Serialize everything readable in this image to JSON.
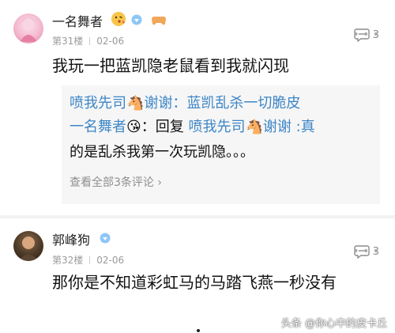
{
  "comments": [
    {
      "user": "一名舞者",
      "floor": "第31楼",
      "date": "02-06",
      "reply_count": "3",
      "text": "我玩一把蓝凯隐老鼠看到我就闪现",
      "quotes": [
        {
          "name": "喷我先司",
          "emoji": "🐴",
          "body": "谢谢：蓝凯乱杀一切脆皮"
        },
        {
          "name": "一名舞者",
          "emoji": "😘",
          "body": "：回复 ",
          "target": "喷我先司",
          "target_emoji": "🐴",
          "tail": "谢谢  :真"
        }
      ],
      "quote_continuation": "的是乱杀我第一次玩凯隐。。。",
      "view_all": "查看全部3条评论 ›"
    },
    {
      "user": "郭峰狗",
      "floor": "第32楼",
      "date": "02-06",
      "reply_count": "3",
      "text": "那你是不知道彩虹马的马踏飞燕一秒没有"
    }
  ],
  "watermark": "头条 @你心中的皮卡丘",
  "colors": {
    "link": "#3d86c6",
    "muted": "#9a9a9a",
    "quote_bg": "#f6f6f6"
  }
}
